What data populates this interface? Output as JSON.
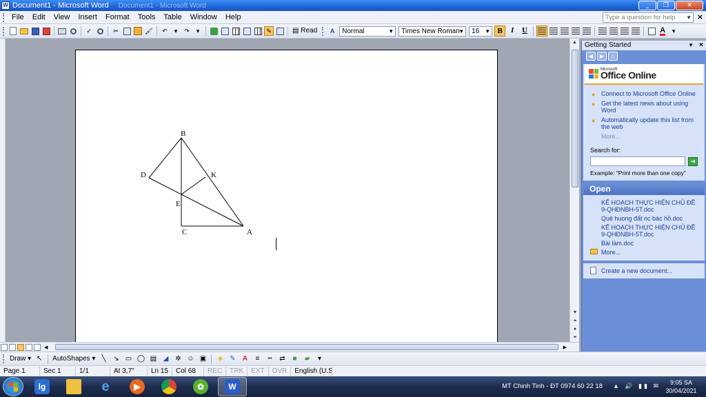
{
  "window": {
    "title": "Document1 - Microsoft Word",
    "ghost_title": "Document1 - Microsoft Word"
  },
  "menu": {
    "items": [
      "File",
      "Edit",
      "View",
      "Insert",
      "Format",
      "Tools",
      "Table",
      "Window",
      "Help"
    ],
    "help_placeholder": "Type a question for help"
  },
  "toolbar": {
    "read_label": "Read",
    "style_value": "Normal",
    "font_value": "Times New Roman",
    "size_value": "16",
    "bold": "B",
    "italic": "I",
    "underline": "U"
  },
  "figure": {
    "points": [
      {
        "id": "B",
        "label": "B"
      },
      {
        "id": "D",
        "label": "D"
      },
      {
        "id": "K",
        "label": "K"
      },
      {
        "id": "E",
        "label": "E"
      },
      {
        "id": "C",
        "label": "C"
      },
      {
        "id": "A",
        "label": "A"
      }
    ]
  },
  "taskpane": {
    "title": "Getting Started",
    "logo_small": "Microsoft",
    "logo_main": "Office Online",
    "links": [
      "Connect to Microsoft Office Online",
      "Get the latest news about using Word",
      "Automatically update this list from the web"
    ],
    "more_link": "More...",
    "search_label": "Search for:",
    "search_value": "",
    "example": "Example:  \"Print more than one copy\"",
    "open_title": "Open",
    "open_files": [
      "KẾ HOẠCH THỰC HIỆN CHỦ ĐỀ 9-QHĐNBH-5T.doc",
      "Quê huong đất nc bác hồ.doc",
      "KẾ HOẠCH THỰC HIỆN CHỦ ĐỀ 9-QHĐNBH-5T.doc",
      "Bài làm.doc"
    ],
    "open_more": "More...",
    "create_new": "Create a new document..."
  },
  "drawbar": {
    "draw_label": "Draw",
    "autoshapes_label": "AutoShapes"
  },
  "status": {
    "page": "Page 1",
    "sec": "Sec 1",
    "pages": "1/1",
    "at": "At 3,7\"",
    "ln": "Ln 15",
    "col": "Col 68",
    "rec": "REC",
    "trk": "TRK",
    "ext": "EXT",
    "ovr": "OVR",
    "lang": "English (U.S."
  },
  "taskbar": {
    "tray_text": "MT Chinh Tinh - ĐT 0974 60 22 18",
    "time": "9:05 SA",
    "date": "30/04/2021"
  },
  "colors": {
    "title_blue": "#1f64d6",
    "taskpane_blue": "#6b8fd6",
    "accent_orange": "#f6c66a"
  }
}
